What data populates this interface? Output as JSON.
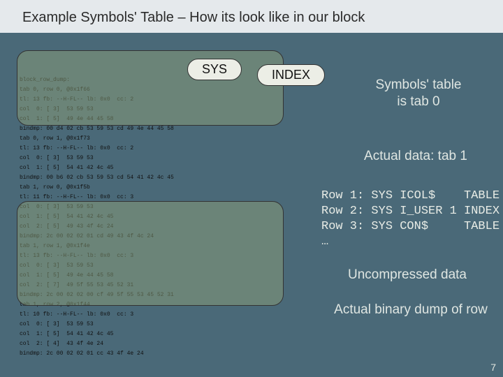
{
  "header": {
    "title": "Example Symbols' Table – How its look like in our block"
  },
  "dump": {
    "lines": [
      "block_row_dump:",
      "tab 0, row 0, @0x1f66",
      "tl: 13 fb: --H-FL-- lb: 0x0  cc: 2",
      "col  0: [ 3]  53 59 53",
      "col  1: [ 5]  49 4e 44 45 58",
      "bindmp: 00 d4 02 cb 53 59 53 cd 49 4e 44 45 58",
      "tab 0, row 1, @0x1f73",
      "tl: 13 fb: --H-FL-- lb: 0x0  cc: 2",
      "col  0: [ 3]  53 59 53",
      "col  1: [ 5]  54 41 42 4c 45",
      "bindmp: 00 b6 02 cb 53 59 53 cd 54 41 42 4c 45",
      "tab 1, row 0, @0x1f5b",
      "tl: 11 fb: --H-FL-- lb: 0x0  cc: 3",
      "col  0: [ 3]  53 59 53",
      "col  1: [ 5]  54 41 42 4c 45",
      "col  2: [ 5]  49 43 4f 4c 24",
      "bindmp: 2c 00 02 02 01 cd 49 43 4f 4c 24",
      "tab 1, row 1, @0x1f4e",
      "tl: 13 fb: --H-FL-- lb: 0x0  cc: 3",
      "col  0: [ 3]  53 59 53",
      "col  1: [ 5]  49 4e 44 45 58",
      "col  2: [ 7]  49 5f 55 53 45 52 31",
      "bindmp: 2c 00 02 02 00 cf 49 5f 55 53 45 52 31",
      "tab 1, row 2, @0x1f44",
      "tl: 10 fb: --H-FL-- lb: 0x0  cc: 3",
      "col  0: [ 3]  53 59 53",
      "col  1: [ 5]  54 41 42 4c 45",
      "col  2: [ 4]  43 4f 4e 24",
      "bindmp: 2c 00 02 02 01 cc 43 4f 4e 24"
    ]
  },
  "badges": {
    "sys": "SYS",
    "index": "INDEX"
  },
  "callouts": {
    "symbols": "Symbols' table\nis tab 0",
    "actual_tab1": "Actual data: tab 1",
    "rows": "Row 1: SYS ICOL$    TABLE\nRow 2: SYS I_USER 1 INDEX\nRow 3: SYS CON$     TABLE\n…",
    "uncompressed": "Uncompressed data",
    "binary": "Actual binary dump of row"
  },
  "page": {
    "num": "7"
  }
}
